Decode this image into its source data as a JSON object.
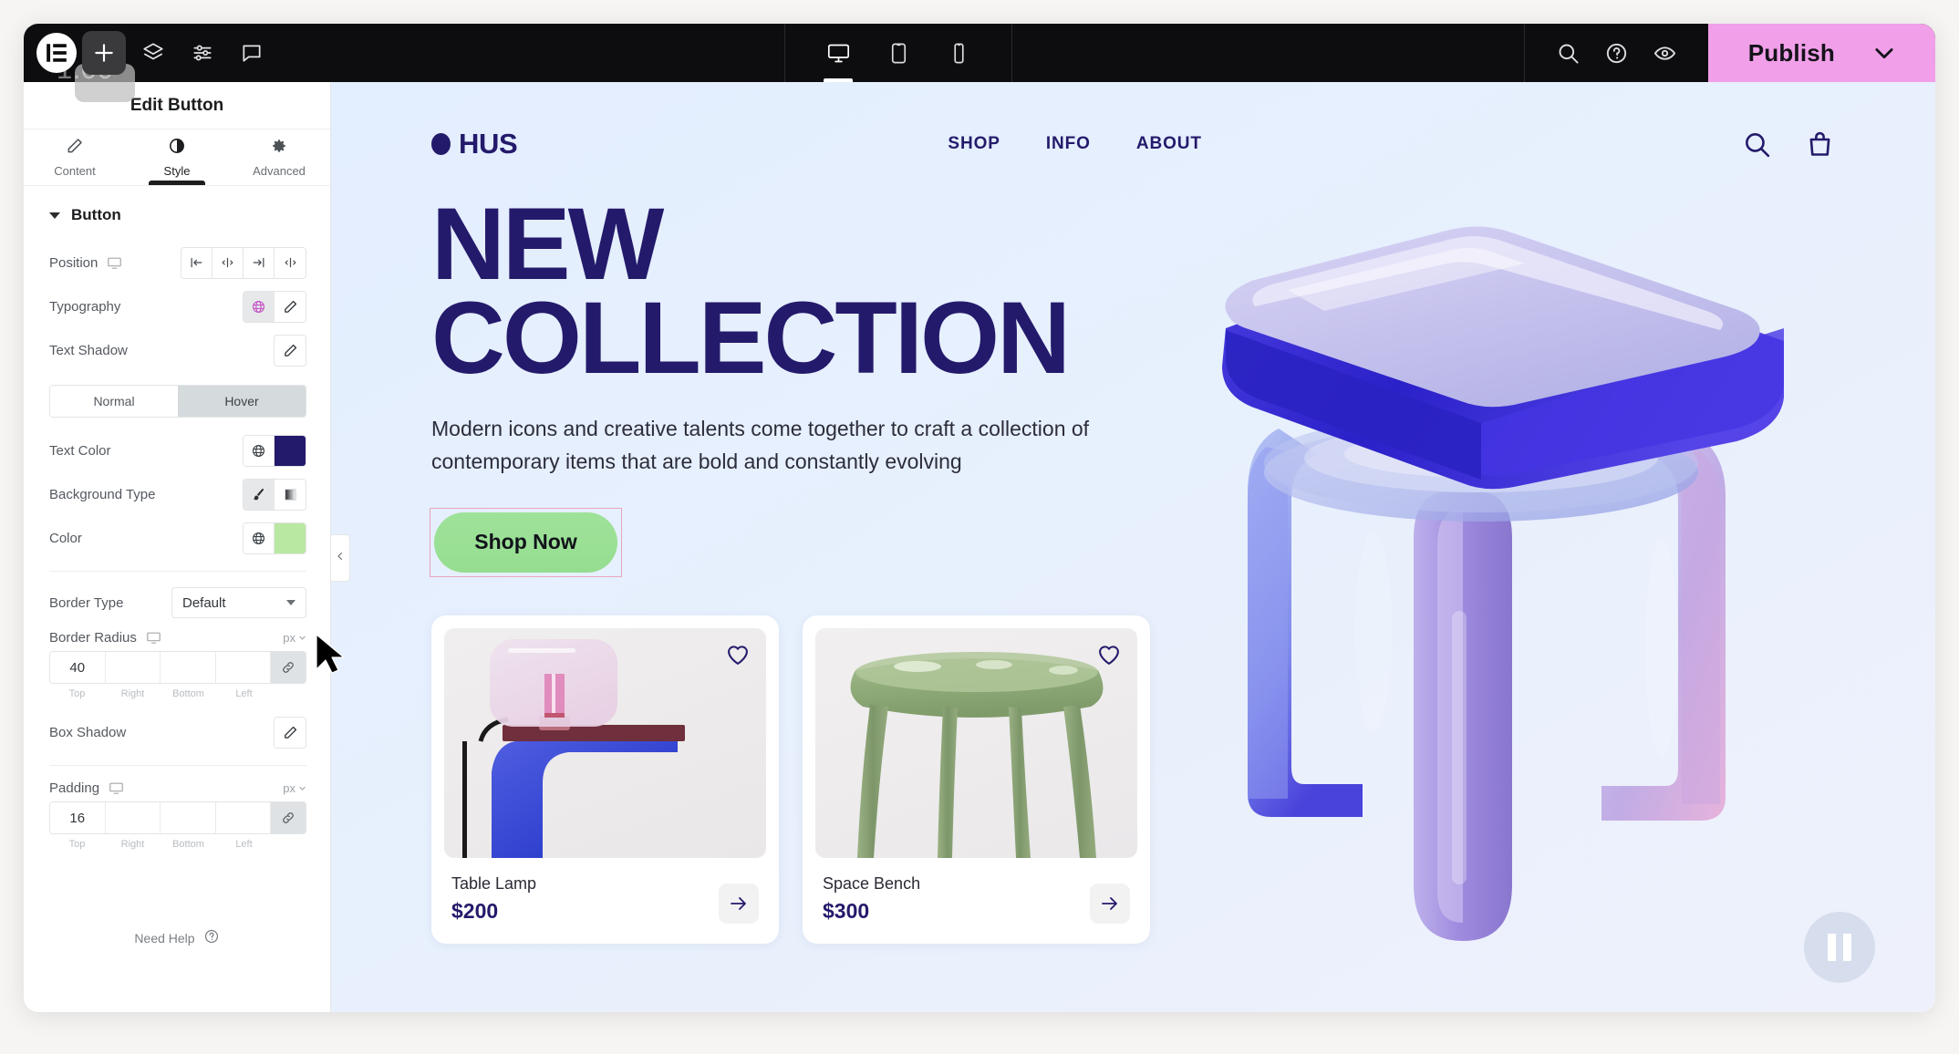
{
  "topbar": {
    "zoom_label": "1.00",
    "menu_icon": "elementor-logo-icon",
    "add_icon": "plus-icon",
    "layers_icon": "layers-icon",
    "settings_icon": "sliders-icon",
    "comments_icon": "comment-bubble-icon",
    "devices": [
      {
        "name": "desktop",
        "icon": "desktop-icon",
        "active": true
      },
      {
        "name": "tablet",
        "icon": "tablet-icon",
        "active": false
      },
      {
        "name": "mobile",
        "icon": "mobile-icon",
        "active": false
      }
    ],
    "search_icon": "search-icon",
    "help_icon": "question-circle-icon",
    "preview_icon": "eye-icon",
    "publish_label": "Publish",
    "publish_caret_icon": "chevron-down-icon",
    "publish_color": "#f09fe8"
  },
  "panel": {
    "title": "Edit Button",
    "tabs": [
      {
        "label": "Content",
        "icon": "pencil-icon",
        "active": false
      },
      {
        "label": "Style",
        "icon": "contrast-circle-icon",
        "active": true
      },
      {
        "label": "Advanced",
        "icon": "gear-icon",
        "active": false
      }
    ],
    "section": {
      "title": "Button",
      "caret_icon": "caret-down-icon"
    },
    "rows": {
      "position": {
        "label": "Position",
        "responsive_icon": "monitor-icon",
        "options": [
          "align-start-icon",
          "align-center-icon",
          "align-end-icon",
          "align-stretch-icon"
        ]
      },
      "typography": {
        "label": "Typography",
        "globe_icon": "globe-icon",
        "edit_icon": "pencil-icon"
      },
      "text_shadow": {
        "label": "Text Shadow",
        "edit_icon": "pencil-icon"
      },
      "state_tabs": [
        {
          "label": "Normal",
          "active": false
        },
        {
          "label": "Hover",
          "active": true
        }
      ],
      "text_color": {
        "label": "Text Color",
        "globe_icon": "globe-icon",
        "swatch": "#241a6b"
      },
      "background_type": {
        "label": "Background Type",
        "classic_icon": "brush-icon",
        "gradient_icon": "gradient-icon"
      },
      "color": {
        "label": "Color",
        "globe_icon": "globe-icon",
        "swatch": "#b9e8a2"
      },
      "border_type": {
        "label": "Border Type",
        "value": "Default",
        "caret_icon": "chevron-down-icon"
      },
      "border_radius": {
        "label": "Border Radius",
        "responsive_icon": "monitor-icon",
        "unit": "px",
        "values": [
          "40",
          "",
          "",
          ""
        ],
        "sides": [
          "Top",
          "Right",
          "Bottom",
          "Left"
        ],
        "link_icon": "link-icon"
      },
      "box_shadow": {
        "label": "Box Shadow",
        "edit_icon": "pencil-icon"
      },
      "padding": {
        "label": "Padding",
        "responsive_icon": "monitor-icon",
        "unit": "px",
        "values": [
          "16",
          "",
          "",
          ""
        ],
        "sides": [
          "Top",
          "Right",
          "Bottom",
          "Left"
        ],
        "link_icon": "link-icon"
      }
    },
    "need_help": {
      "label": "Need Help",
      "icon": "question-circle-icon"
    },
    "collapse_icon": "chevron-left-icon"
  },
  "site": {
    "brand": "HUS",
    "nav": [
      "SHOP",
      "INFO",
      "ABOUT"
    ],
    "search_icon": "search-icon",
    "bag_icon": "shopping-bag-icon",
    "hero": {
      "line1": "NEW",
      "line2": "COLLECTION",
      "paragraph": "Modern icons and creative talents come together to craft a collection of contemporary items that are bold and constantly evolving",
      "cta": "Shop Now"
    },
    "products": [
      {
        "name": "Table Lamp",
        "price": "$200",
        "favorite_icon": "heart-icon",
        "arrow_icon": "arrow-right-icon"
      },
      {
        "name": "Space Bench",
        "price": "$300",
        "favorite_icon": "heart-icon",
        "arrow_icon": "arrow-right-icon"
      }
    ],
    "pause_icon": "pause-icon"
  }
}
